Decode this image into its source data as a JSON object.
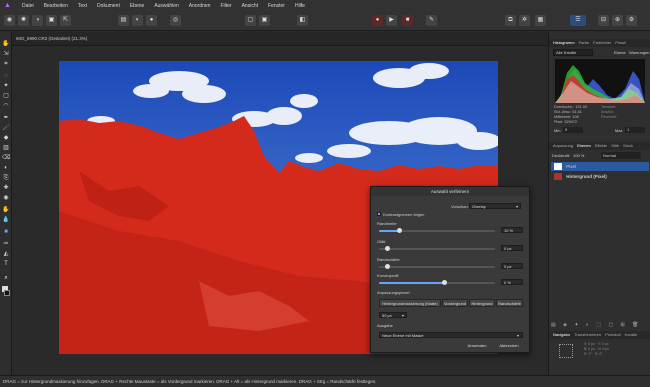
{
  "menu": [
    "Datei",
    "Bearbeiten",
    "Text",
    "Dokument",
    "Ebene",
    "Auswählen",
    "Anordnen",
    "Filter",
    "Ansicht",
    "Fenster",
    "Hilfe"
  ],
  "document_tab": "IMG_6990.CR2 (Geändert) (21.3%)",
  "right": {
    "tabs": [
      "Histogramm",
      "Farbe",
      "Farbfelder",
      "Pinsel"
    ],
    "channel_select": "Alle Kanäle",
    "layer_option": "Ebene",
    "warning_option": "Warnungen",
    "stats": {
      "mean": "Durchschn.: 131.00",
      "std": "Std.-Abw.: 61.61",
      "median": "Mittelwert: 108",
      "pixels": "Pixel: 329472",
      "min_label": "Min",
      "min": "0",
      "max_label": "Max",
      "max": "1",
      "levels": "Tonstufe:",
      "count": "Anzahl:",
      "percentile": "Perzentil:"
    },
    "layer_tabs": [
      "Anpassung",
      "Ebenen",
      "Effekte",
      "Stile",
      "Stock"
    ],
    "opacity_label": "Deckkraft:",
    "opacity": "100 %",
    "blend": "Normal",
    "layers": [
      "Pixel",
      "Hintergrund (Pixel)"
    ],
    "nav_tabs": [
      "Navigator",
      "Transformieren",
      "Protokoll",
      "Kanäle"
    ]
  },
  "dialog": {
    "title": "Auswahl verfeinern",
    "preview_label": "Vorschau:",
    "preview_value": "Overlay",
    "checkbox": "Kontrastgrenzen folgen",
    "border_width": "Randbreite",
    "border_width_value": "10 %",
    "smooth": "Glätt",
    "smooth_value": "0 px",
    "edge": "Randschärfe",
    "edge_value": "0 px",
    "ramp": "Kurvenprofil",
    "ramp_value": "0 %",
    "brush_label": "Anpassungspinsel",
    "brush_buttons": [
      "Hintergrundmaskierung (Matte)",
      "Vordergrund",
      "Hintergrund",
      "Randschärfe"
    ],
    "brush_size": "50 px",
    "output_label": "Ausgabe",
    "output_value": "Neue Ebene mit Maske",
    "apply": "Anwenden",
    "cancel": "Abbrechen"
  },
  "status": "DRAG = zur Hintergrundmaskierung hinzufügen. DRAG + Rechte Maustaste = als Vordergrund markieren. DRAG + Alt = als Hintergrund markieren. DRAG + Strg = Randschärfe festlegen."
}
